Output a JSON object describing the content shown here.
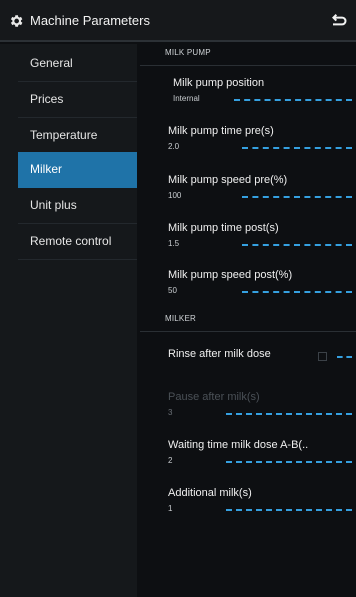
{
  "header": {
    "title": "Machine Parameters",
    "icon": "gear-icon",
    "back_icon": "back-arrow-icon"
  },
  "sidebar": {
    "items": [
      {
        "label": "General",
        "active": false
      },
      {
        "label": "Prices",
        "active": false
      },
      {
        "label": "Temperature",
        "active": false
      },
      {
        "label": "Milker",
        "active": true
      },
      {
        "label": "Unit plus",
        "active": false
      },
      {
        "label": "Remote control",
        "active": false
      }
    ]
  },
  "sections": {
    "milk_pump": "MILK PUMP",
    "milker": "MILKER"
  },
  "settings": {
    "pump_position": {
      "label": "Milk pump position",
      "value": "Internal"
    },
    "pump_time_pre": {
      "label": "Milk pump time pre(s)",
      "value": "2.0"
    },
    "pump_speed_pre": {
      "label": "Milk pump speed pre(%)",
      "value": "100"
    },
    "pump_time_post": {
      "label": "Milk pump time post(s)",
      "value": "1.5"
    },
    "pump_speed_post": {
      "label": "Milk pump speed post(%)",
      "value": "50"
    },
    "rinse": {
      "label": "Rinse after milk dose",
      "checked": false
    },
    "pause": {
      "label": "Pause after milk(s)",
      "value": "3"
    },
    "waiting": {
      "label": "Waiting time milk dose A-B(..",
      "value": "2"
    },
    "additional": {
      "label": "Additional milk(s)",
      "value": "1"
    }
  },
  "colors": {
    "accent": "#1f73a8",
    "dash": "#35a0e0",
    "background": "#0d0f12"
  }
}
